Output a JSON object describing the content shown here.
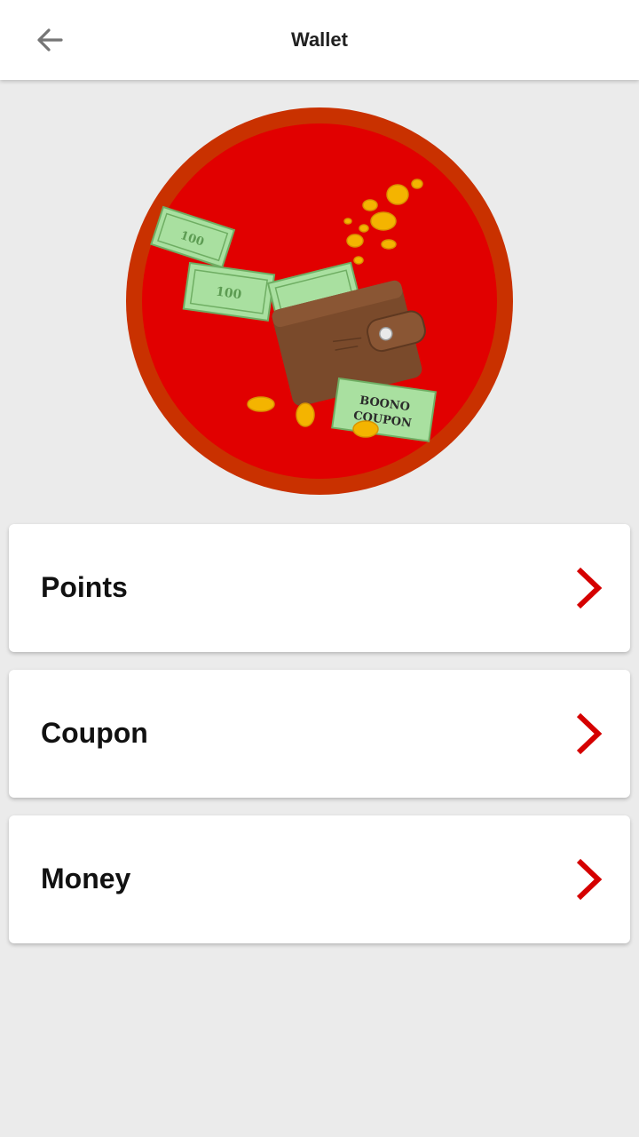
{
  "header": {
    "title": "Wallet",
    "back_icon": "arrow-left-icon"
  },
  "hero": {
    "badge_text_line1": "BOONO",
    "badge_text_line2": "COUPON",
    "bill_value": "100",
    "colors": {
      "ring": "#c93100",
      "disc": "#e10000",
      "wallet": "#7a4a2b",
      "bill": "#a9e0a0",
      "coin": "#f4b400"
    }
  },
  "menu": {
    "items": [
      {
        "label": "Points",
        "icon": "chevron-right-icon"
      },
      {
        "label": "Coupon",
        "icon": "chevron-right-icon"
      },
      {
        "label": "Money",
        "icon": "chevron-right-icon"
      }
    ]
  },
  "colors": {
    "accent": "#d50000",
    "background": "#ebebeb",
    "card": "#ffffff"
  }
}
